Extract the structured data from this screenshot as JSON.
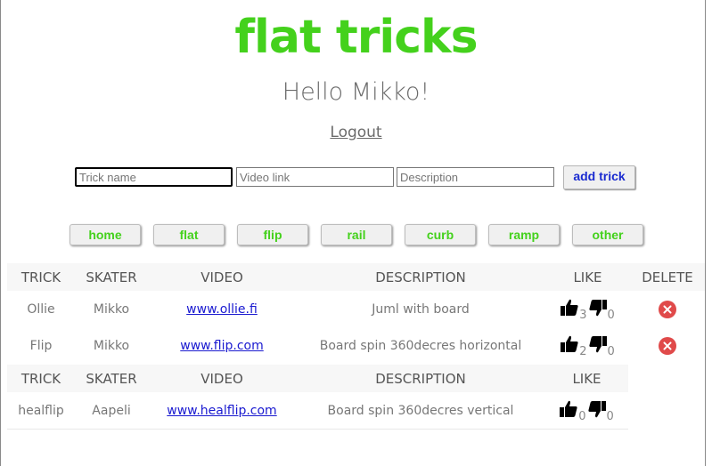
{
  "header": {
    "title": "flat tricks",
    "greeting": "Hello Mikko!",
    "logout": "Logout"
  },
  "form": {
    "trick_placeholder": "Trick name",
    "video_placeholder": "Video link",
    "description_placeholder": "Description",
    "add_label": "add trick"
  },
  "nav": [
    "home",
    "flat",
    "flip",
    "rail",
    "curb",
    "ramp",
    "other"
  ],
  "colors": {
    "title": "#44d11c",
    "link": "#1a1ad0",
    "delete": "#e04a4a"
  },
  "table1": {
    "headers": [
      "TRICK",
      "SKATER",
      "VIDEO",
      "DESCRIPTION",
      "LIKE",
      "DELETE"
    ],
    "rows": [
      {
        "trick": "Ollie",
        "skater": "Mikko",
        "video": "www.ollie.fi",
        "description": "Juml with board",
        "likes": "3",
        "dislikes": "0"
      },
      {
        "trick": "Flip",
        "skater": "Mikko",
        "video": "www.flip.com",
        "description": "Board spin 360decres horizontal",
        "likes": "2",
        "dislikes": "0"
      }
    ]
  },
  "table2": {
    "headers": [
      "TRICK",
      "SKATER",
      "VIDEO",
      "DESCRIPTION",
      "LIKE"
    ],
    "rows": [
      {
        "trick": "healflip",
        "skater": "Aapeli",
        "video": "www.healflip.com",
        "description": "Board spin 360decres vertical",
        "likes": "0",
        "dislikes": "0"
      }
    ]
  },
  "icons": {
    "like": "thumbs-up-icon",
    "dislike": "thumbs-down-icon",
    "delete": "close-icon"
  }
}
